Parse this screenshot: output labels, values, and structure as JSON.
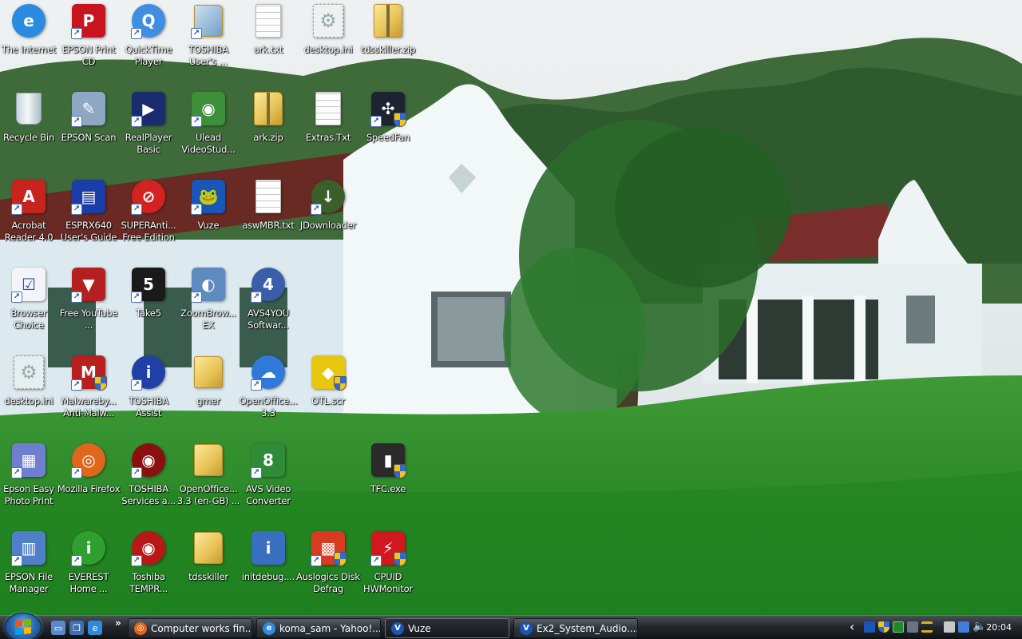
{
  "desktop": {
    "icons": [
      {
        "label": "The Internet",
        "icon": "internet-explorer-icon",
        "color": "#2a8be0",
        "glyph": "e",
        "col": 0,
        "row": 0,
        "type": "round",
        "shortcut": false
      },
      {
        "label": "EPSON Print CD",
        "icon": "epson-print-cd-icon",
        "color": "#c8141e",
        "glyph": "P",
        "col": 1,
        "row": 0,
        "type": "box",
        "shortcut": true
      },
      {
        "label": "QuickTime Player",
        "icon": "quicktime-icon",
        "color": "#3f8ee2",
        "glyph": "Q",
        "col": 2,
        "row": 0,
        "type": "round",
        "shortcut": true
      },
      {
        "label": "TOSHIBA User's ...",
        "icon": "toshiba-manual-icon",
        "color": "#6f9fc8",
        "glyph": "",
        "col": 3,
        "row": 0,
        "type": "folder",
        "shortcut": true
      },
      {
        "label": "ark.txt",
        "icon": "text-document-icon",
        "color": "#ffffff",
        "glyph": "",
        "col": 4,
        "row": 0,
        "type": "doc",
        "shortcut": false
      },
      {
        "label": "desktop.ini",
        "icon": "settings-file-icon",
        "color": "#dddddd",
        "glyph": "⚙",
        "col": 5,
        "row": 0,
        "type": "gear",
        "shortcut": false
      },
      {
        "label": "tdsskiller.zip",
        "icon": "zip-folder-icon",
        "color": "#e8c55a",
        "glyph": "",
        "col": 6,
        "row": 0,
        "type": "zip",
        "shortcut": false
      },
      {
        "label": "Recycle Bin",
        "icon": "recycle-bin-icon",
        "color": "#c6d3dc",
        "glyph": "",
        "col": 0,
        "row": 1,
        "type": "bin",
        "shortcut": false
      },
      {
        "label": "EPSON Scan",
        "icon": "epson-scan-icon",
        "color": "#8ea7c2",
        "glyph": "✎",
        "col": 1,
        "row": 1,
        "type": "box",
        "shortcut": true
      },
      {
        "label": "RealPlayer Basic",
        "icon": "realplayer-icon",
        "color": "#1a2c6e",
        "glyph": "▶",
        "col": 2,
        "row": 1,
        "type": "box",
        "shortcut": true
      },
      {
        "label": "Ulead VideoStud...",
        "icon": "ulead-videostudio-icon",
        "color": "#3d8f3a",
        "glyph": "◉",
        "col": 3,
        "row": 1,
        "type": "box",
        "shortcut": true
      },
      {
        "label": "ark.zip",
        "icon": "zip-folder-icon",
        "color": "#e8c55a",
        "glyph": "",
        "col": 4,
        "row": 1,
        "type": "zip",
        "shortcut": false
      },
      {
        "label": "Extras.Txt",
        "icon": "text-document-icon",
        "color": "#ffffff",
        "glyph": "",
        "col": 5,
        "row": 1,
        "type": "doc",
        "shortcut": false
      },
      {
        "label": "SpeedFan",
        "icon": "speedfan-icon",
        "color": "#1b2430",
        "glyph": "✣",
        "col": 6,
        "row": 1,
        "type": "box",
        "shortcut": true,
        "shield": true
      },
      {
        "label": "Acrobat Reader 4.0",
        "icon": "acrobat-reader-icon",
        "color": "#c8241e",
        "glyph": "A",
        "col": 0,
        "row": 2,
        "type": "box",
        "shortcut": true
      },
      {
        "label": "ESPRX640 User's Guide",
        "icon": "epson-guide-icon",
        "color": "#1b3da8",
        "glyph": "▤",
        "col": 1,
        "row": 2,
        "type": "box",
        "shortcut": true
      },
      {
        "label": "SUPERAnti... Free Edition",
        "icon": "superantispyware-icon",
        "color": "#d22222",
        "glyph": "⊘",
        "col": 2,
        "row": 2,
        "type": "round",
        "shortcut": true
      },
      {
        "label": "Vuze",
        "icon": "vuze-icon",
        "color": "#1a55b8",
        "glyph": "🐸",
        "col": 3,
        "row": 2,
        "type": "box",
        "shortcut": true
      },
      {
        "label": "aswMBR.txt",
        "icon": "text-document-icon",
        "color": "#ffffff",
        "glyph": "",
        "col": 4,
        "row": 2,
        "type": "doc",
        "shortcut": false
      },
      {
        "label": "JDownloader",
        "icon": "jdownloader-icon",
        "color": "#3b5e2a",
        "glyph": "↓",
        "col": 5,
        "row": 2,
        "type": "round",
        "shortcut": true
      },
      {
        "label": "Browser Choice",
        "icon": "browser-choice-icon",
        "color": "#f2f4f8",
        "glyph": "☑",
        "col": 0,
        "row": 3,
        "type": "box",
        "shortcut": true
      },
      {
        "label": "Free YouTube ...",
        "icon": "youtube-downloader-icon",
        "color": "#b42020",
        "glyph": "▼",
        "col": 1,
        "row": 3,
        "type": "box",
        "shortcut": true
      },
      {
        "label": "Take5",
        "icon": "take5-icon",
        "color": "#1a1a1a",
        "glyph": "5",
        "col": 2,
        "row": 3,
        "type": "box",
        "shortcut": true
      },
      {
        "label": "ZoomBrow... EX",
        "icon": "zoombrowser-icon",
        "color": "#5e8bbf",
        "glyph": "◐",
        "col": 3,
        "row": 3,
        "type": "box",
        "shortcut": true
      },
      {
        "label": "AVS4YOU Softwar...",
        "icon": "avs4you-icon",
        "color": "#3a5ea8",
        "glyph": "4",
        "col": 4,
        "row": 3,
        "type": "round",
        "shortcut": true
      },
      {
        "label": "desktop.ini",
        "icon": "settings-file-icon",
        "color": "#dddddd",
        "glyph": "⚙",
        "col": 0,
        "row": 4,
        "type": "gear",
        "shortcut": false
      },
      {
        "label": "Malwareby... Anti-Malw...",
        "icon": "malwarebytes-icon",
        "color": "#b82020",
        "glyph": "M",
        "col": 1,
        "row": 4,
        "type": "box",
        "shortcut": true,
        "shield": true
      },
      {
        "label": "TOSHIBA Assist",
        "icon": "toshiba-assist-icon",
        "color": "#2040a8",
        "glyph": "i",
        "col": 2,
        "row": 4,
        "type": "round",
        "shortcut": true
      },
      {
        "label": "gmer",
        "icon": "folder-icon",
        "color": "#e8c55a",
        "glyph": "",
        "col": 3,
        "row": 4,
        "type": "folder",
        "shortcut": false
      },
      {
        "label": "OpenOffice... 3.3",
        "icon": "openoffice-icon",
        "color": "#2f7ad8",
        "glyph": "☁",
        "col": 4,
        "row": 4,
        "type": "round",
        "shortcut": true
      },
      {
        "label": "OTL.scr",
        "icon": "otl-icon",
        "color": "#e6c60e",
        "glyph": "◆",
        "col": 5,
        "row": 4,
        "type": "box",
        "shortcut": false,
        "shield": true
      },
      {
        "label": "Epson Easy Photo Print",
        "icon": "epson-photo-print-icon",
        "color": "#6f7fd0",
        "glyph": "▦",
        "col": 0,
        "row": 5,
        "type": "box",
        "shortcut": true
      },
      {
        "label": "Mozilla Firefox",
        "icon": "firefox-icon",
        "color": "#e0661c",
        "glyph": "◎",
        "col": 1,
        "row": 5,
        "type": "round",
        "shortcut": true
      },
      {
        "label": "TOSHIBA Services a...",
        "icon": "toshiba-services-icon",
        "color": "#8a1010",
        "glyph": "◉",
        "col": 2,
        "row": 5,
        "type": "round",
        "shortcut": true
      },
      {
        "label": "OpenOffice... 3.3 (en-GB) ...",
        "icon": "folder-icon",
        "color": "#e8c55a",
        "glyph": "",
        "col": 3,
        "row": 5,
        "type": "folder",
        "shortcut": false
      },
      {
        "label": "AVS Video Converter",
        "icon": "avs-video-converter-icon",
        "color": "#2f8a3a",
        "glyph": "8",
        "col": 4,
        "row": 5,
        "type": "box",
        "shortcut": true
      },
      {
        "label": "TFC.exe",
        "icon": "trash-can-icon",
        "color": "#2a2a2a",
        "glyph": "▮",
        "col": 6,
        "row": 5,
        "type": "box",
        "shortcut": false,
        "shield": true
      },
      {
        "label": "EPSON File Manager",
        "icon": "epson-file-manager-icon",
        "color": "#4f7fc8",
        "glyph": "▥",
        "col": 0,
        "row": 6,
        "type": "box",
        "shortcut": true
      },
      {
        "label": "EVEREST Home ...",
        "icon": "everest-icon",
        "color": "#2fa02f",
        "glyph": "i",
        "col": 1,
        "row": 6,
        "type": "round",
        "shortcut": true
      },
      {
        "label": "Toshiba TEMPR...",
        "icon": "toshiba-tempro-icon",
        "color": "#b81818",
        "glyph": "◉",
        "col": 2,
        "row": 6,
        "type": "round",
        "shortcut": true
      },
      {
        "label": "tdsskiller",
        "icon": "folder-icon",
        "color": "#e8c55a",
        "glyph": "",
        "col": 3,
        "row": 6,
        "type": "folder",
        "shortcut": false
      },
      {
        "label": "initdebug....",
        "icon": "system-info-icon",
        "color": "#3a6fc0",
        "glyph": "i",
        "col": 4,
        "row": 6,
        "type": "box",
        "shortcut": false
      },
      {
        "label": "Auslogics Disk Defrag",
        "icon": "auslogics-defrag-icon",
        "color": "#d83a22",
        "glyph": "▩",
        "col": 5,
        "row": 6,
        "type": "box",
        "shortcut": true,
        "shield": true
      },
      {
        "label": "CPUID HWMonitor",
        "icon": "hwmonitor-icon",
        "color": "#d0181e",
        "glyph": "⚡",
        "col": 6,
        "row": 6,
        "type": "box",
        "shortcut": true,
        "shield": true
      }
    ]
  },
  "taskbar": {
    "quick_launch": [
      {
        "icon": "show-desktop-icon",
        "color": "#5a88c8",
        "glyph": "▭"
      },
      {
        "icon": "switch-windows-icon",
        "color": "#3f6fb0",
        "glyph": "❐"
      },
      {
        "icon": "internet-explorer-icon",
        "color": "#2a8be0",
        "glyph": "e"
      }
    ],
    "more": "»",
    "tasks": [
      {
        "label": "Computer works fin...",
        "icon": "firefox-icon",
        "color": "#e0661c",
        "glyph": "◎",
        "active": false
      },
      {
        "label": "koma_sam - Yahoo!...",
        "icon": "internet-explorer-icon",
        "color": "#2a8be0",
        "glyph": "e",
        "active": false
      },
      {
        "label": "Vuze",
        "icon": "vuze-icon",
        "color": "#1a55b8",
        "glyph": "V",
        "active": true
      },
      {
        "label": "Ex2_System_Audio....",
        "icon": "vuze-icon",
        "color": "#1a55b8",
        "glyph": "V",
        "active": false
      }
    ],
    "tray": {
      "expand": "‹",
      "clock": "20:04"
    }
  },
  "colors": {
    "taskbar_top": "#4a4f56",
    "taskbar_bottom": "#0f1114",
    "label_text": "#ffffff"
  }
}
